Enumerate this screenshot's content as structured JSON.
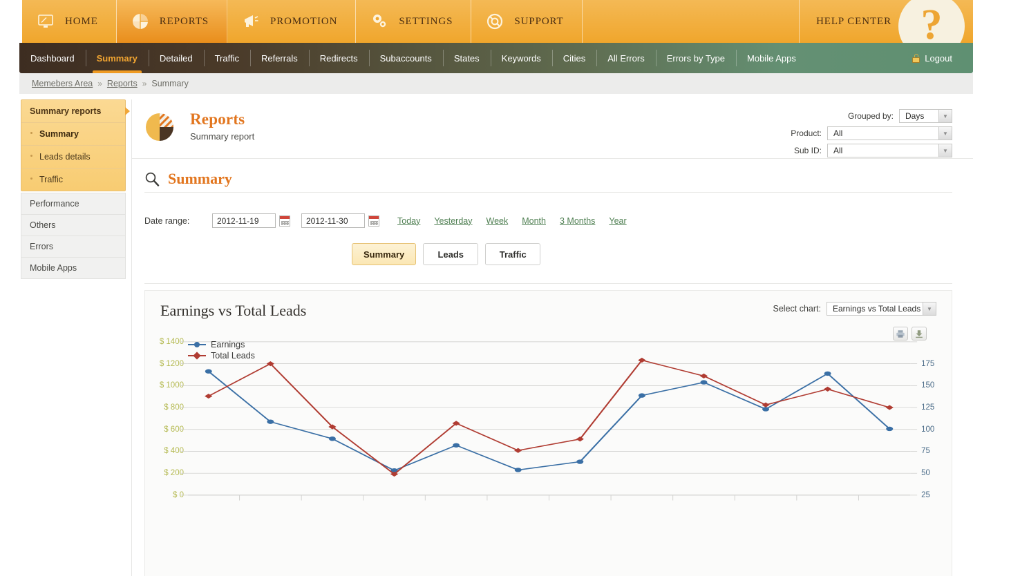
{
  "topnav": {
    "items": [
      {
        "label": "Home",
        "icon": "monitor-icon",
        "active": false
      },
      {
        "label": "Reports",
        "icon": "pie-chart-icon",
        "active": true
      },
      {
        "label": "Promotion",
        "icon": "megaphone-icon",
        "active": false
      },
      {
        "label": "Settings",
        "icon": "gears-icon",
        "active": false
      },
      {
        "label": "Support",
        "icon": "lifebuoy-icon",
        "active": false
      }
    ],
    "help_center": "Help Center",
    "help_badge": "?"
  },
  "subnav": {
    "items": [
      {
        "label": "Dashboard",
        "active": false
      },
      {
        "label": "Summary",
        "active": true
      },
      {
        "label": "Detailed",
        "active": false
      },
      {
        "label": "Traffic",
        "active": false
      },
      {
        "label": "Referrals",
        "active": false
      },
      {
        "label": "Redirects",
        "active": false
      },
      {
        "label": "Subaccounts",
        "active": false
      },
      {
        "label": "States",
        "active": false
      },
      {
        "label": "Keywords",
        "active": false
      },
      {
        "label": "Cities",
        "active": false
      },
      {
        "label": "All Errors",
        "active": false
      },
      {
        "label": "Errors by Type",
        "active": false
      },
      {
        "label": "Mobile Apps",
        "active": false
      }
    ],
    "logout": "Logout"
  },
  "breadcrumb": {
    "items": [
      "Memebers Area",
      "Reports",
      "Summary"
    ],
    "separator": "»"
  },
  "sidebar": {
    "group_title": "Summary reports",
    "sub_items": [
      {
        "label": "Summary",
        "active": true
      },
      {
        "label": "Leads details",
        "active": false
      },
      {
        "label": "Traffic",
        "active": false
      }
    ],
    "plain_items": [
      {
        "label": "Performance"
      },
      {
        "label": "Others"
      },
      {
        "label": "Errors"
      },
      {
        "label": "Mobile Apps"
      }
    ]
  },
  "panel": {
    "title": "Reports",
    "subtitle": "Summary report",
    "icon": "pie-chart-icon"
  },
  "filters": [
    {
      "label": "Grouped by:",
      "value": "Days",
      "width": "days"
    },
    {
      "label": "Product:",
      "value": "All",
      "width": "wide"
    },
    {
      "label": "Sub ID:",
      "value": "All",
      "width": "wide"
    }
  ],
  "section": {
    "title": "Summary",
    "icon": "magnifier-icon"
  },
  "daterange": {
    "label": "Date range:",
    "from": "2012-11-19",
    "to": "2012-11-30",
    "quick_links": [
      "Today",
      "Yesterday",
      "Week",
      "Month",
      "3 Months",
      "Year"
    ]
  },
  "tab_buttons": [
    {
      "label": "Summary",
      "active": true
    },
    {
      "label": "Leads",
      "active": false
    },
    {
      "label": "Traffic",
      "active": false
    }
  ],
  "chart_panel": {
    "title": "Earnings vs Total Leads",
    "select_label": "Select chart:",
    "select_value": "Earnings vs Total Leads",
    "print_icon": "printer-icon",
    "download_icon": "download-icon"
  },
  "chart_data": {
    "type": "line",
    "title": "Earnings vs Total Leads",
    "xlabel": "",
    "ylabel": "",
    "grid": true,
    "legend_position": "top-left",
    "axes": {
      "left": {
        "name": "Earnings",
        "prefix": "$ ",
        "ticks": [
          0,
          200,
          400,
          600,
          800,
          1000,
          1200,
          1400
        ],
        "tick_labels": [
          "$ 0",
          "$ 200",
          "$ 400",
          "$ 600",
          "$ 800",
          "$ 1000",
          "$ 1200",
          "$ 1400"
        ],
        "range": [
          0,
          1400
        ],
        "color": "#b5ba52"
      },
      "right": {
        "name": "Total Leads",
        "ticks": [
          25,
          50,
          75,
          100,
          125,
          150,
          175
        ],
        "tick_labels": [
          "25",
          "50",
          "75",
          "100",
          "125",
          "150",
          "175"
        ],
        "range": [
          0,
          200
        ],
        "color": "#4a6b88"
      }
    },
    "series": [
      {
        "name": "Earnings",
        "axis": "left",
        "color": "#3a6fa5",
        "marker": "circle",
        "values": [
          1130,
          670,
          515,
          225,
          455,
          230,
          305,
          910,
          1030,
          785,
          1110,
          605
        ]
      },
      {
        "name": "Total Leads",
        "axis": "right",
        "color": "#b03c32",
        "marker": "diamond",
        "values": [
          138,
          175,
          103,
          49,
          107,
          76,
          89,
          179,
          161,
          128,
          146,
          125
        ]
      }
    ],
    "x_count": 12
  }
}
